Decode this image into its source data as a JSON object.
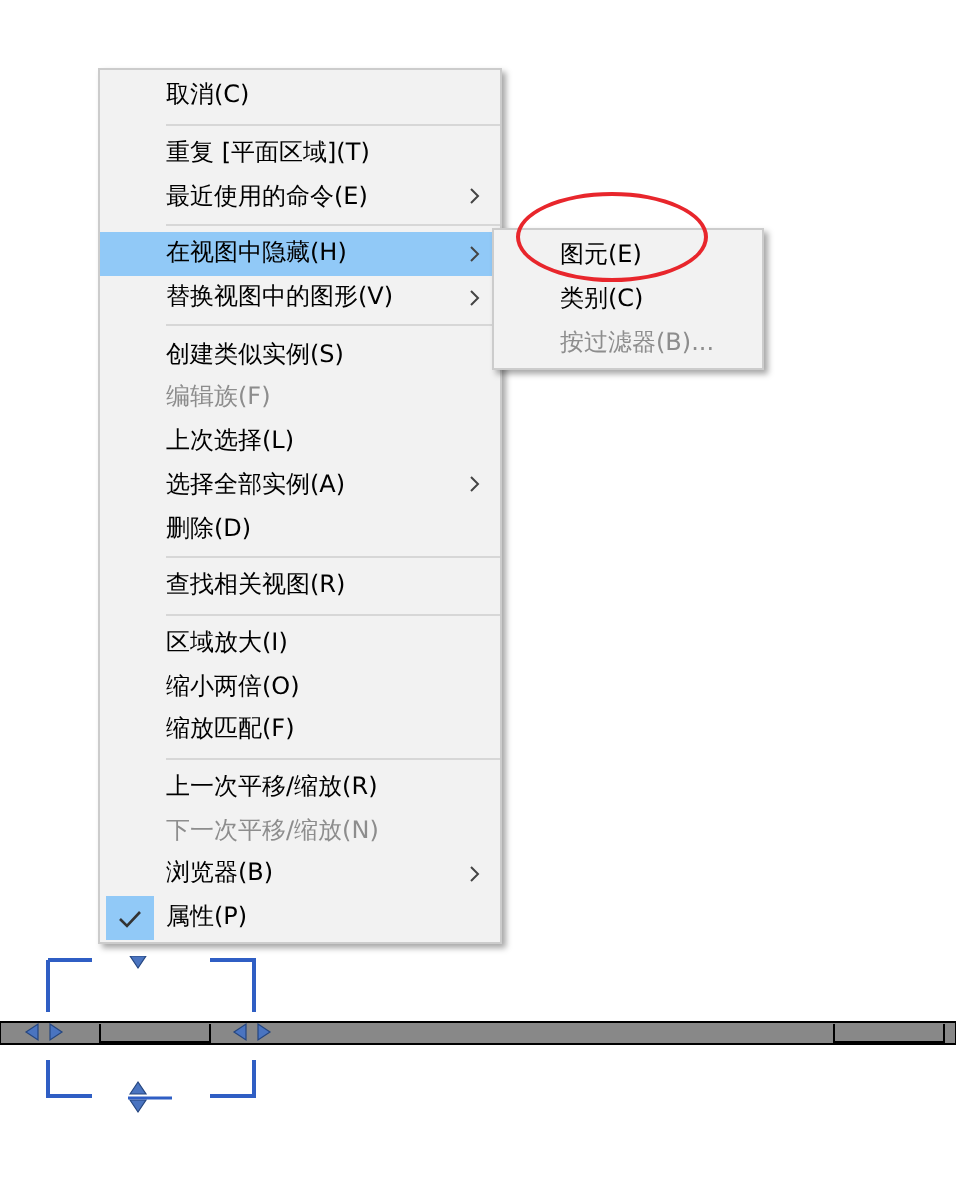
{
  "context_menu": {
    "items": [
      {
        "kind": "item",
        "label": "取消(C)",
        "disabled": false,
        "submenu": false,
        "selected": false,
        "checked": false
      },
      {
        "kind": "separator"
      },
      {
        "kind": "item",
        "label": "重复 [平面区域](T)",
        "disabled": false,
        "submenu": false,
        "selected": false,
        "checked": false
      },
      {
        "kind": "item",
        "label": "最近使用的命令(E)",
        "disabled": false,
        "submenu": true,
        "selected": false,
        "checked": false
      },
      {
        "kind": "separator"
      },
      {
        "kind": "item",
        "label": "在视图中隐藏(H)",
        "disabled": false,
        "submenu": true,
        "selected": true,
        "checked": false
      },
      {
        "kind": "item",
        "label": "替换视图中的图形(V)",
        "disabled": false,
        "submenu": true,
        "selected": false,
        "checked": false
      },
      {
        "kind": "separator"
      },
      {
        "kind": "item",
        "label": "创建类似实例(S)",
        "disabled": false,
        "submenu": false,
        "selected": false,
        "checked": false
      },
      {
        "kind": "item",
        "label": "编辑族(F)",
        "disabled": true,
        "submenu": false,
        "selected": false,
        "checked": false
      },
      {
        "kind": "item",
        "label": "上次选择(L)",
        "disabled": false,
        "submenu": false,
        "selected": false,
        "checked": false
      },
      {
        "kind": "item",
        "label": "选择全部实例(A)",
        "disabled": false,
        "submenu": true,
        "selected": false,
        "checked": false
      },
      {
        "kind": "item",
        "label": "删除(D)",
        "disabled": false,
        "submenu": false,
        "selected": false,
        "checked": false
      },
      {
        "kind": "separator"
      },
      {
        "kind": "item",
        "label": "查找相关视图(R)",
        "disabled": false,
        "submenu": false,
        "selected": false,
        "checked": false
      },
      {
        "kind": "separator"
      },
      {
        "kind": "item",
        "label": "区域放大(I)",
        "disabled": false,
        "submenu": false,
        "selected": false,
        "checked": false
      },
      {
        "kind": "item",
        "label": "缩小两倍(O)",
        "disabled": false,
        "submenu": false,
        "selected": false,
        "checked": false
      },
      {
        "kind": "item",
        "label": "缩放匹配(F)",
        "disabled": false,
        "submenu": false,
        "selected": false,
        "checked": false
      },
      {
        "kind": "separator"
      },
      {
        "kind": "item",
        "label": "上一次平移/缩放(R)",
        "disabled": false,
        "submenu": false,
        "selected": false,
        "checked": false
      },
      {
        "kind": "item",
        "label": "下一次平移/缩放(N)",
        "disabled": true,
        "submenu": false,
        "selected": false,
        "checked": false
      },
      {
        "kind": "item",
        "label": "浏览器(B)",
        "disabled": false,
        "submenu": true,
        "selected": false,
        "checked": false
      },
      {
        "kind": "item",
        "label": "属性(P)",
        "disabled": false,
        "submenu": false,
        "selected": false,
        "checked": true
      }
    ]
  },
  "submenu": {
    "items": [
      {
        "label": "图元(E)",
        "disabled": false,
        "circled": true
      },
      {
        "label": "类别(C)",
        "disabled": false,
        "circled": false
      },
      {
        "label": "按过滤器(B)...",
        "disabled": true,
        "circled": false
      }
    ]
  }
}
